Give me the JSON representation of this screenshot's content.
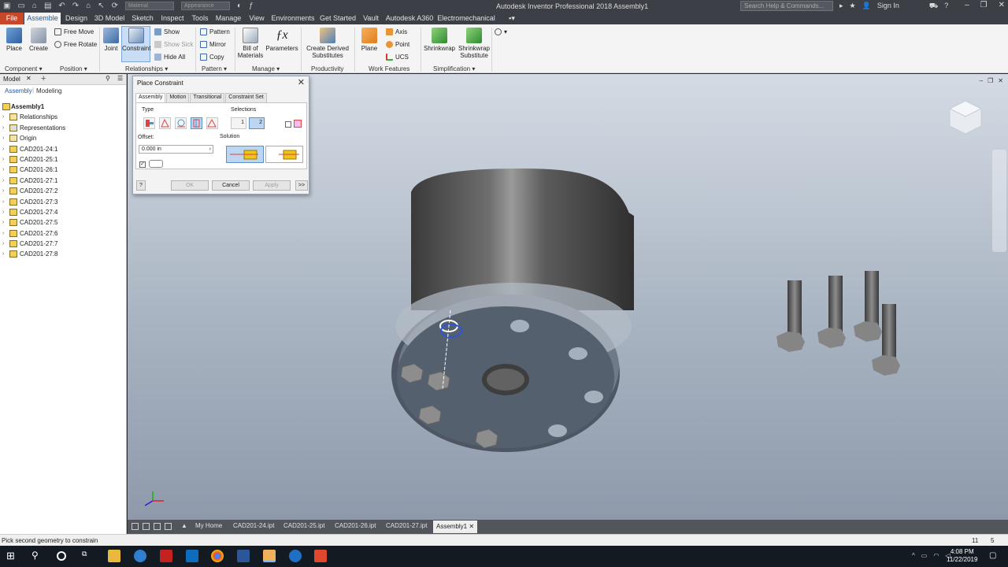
{
  "app": {
    "title": "Autodesk Inventor Professional 2018   Assembly1",
    "qat_combo_material": "Material",
    "qat_combo_appearance": "Appearance",
    "search_placeholder": "Search Help & Commands...",
    "sign_in": "Sign In"
  },
  "menu": {
    "tabs": [
      "File",
      "Assemble",
      "Design",
      "3D Model",
      "Sketch",
      "Inspect",
      "Tools",
      "Manage",
      "View",
      "Environments",
      "Get Started",
      "Vault",
      "Autodesk A360",
      "Electromechanical"
    ],
    "active": "Assemble"
  },
  "ribbon": {
    "place": "Place",
    "create": "Create",
    "free_move": "Free Move",
    "free_rotate": "Free Rotate",
    "joint": "Joint",
    "constraint": "Constraint",
    "show": "Show",
    "show_sick": "Show Sick",
    "hide_all": "Hide All",
    "pattern": "Pattern",
    "mirror": "Mirror",
    "copy": "Copy",
    "bill_of_materials_1": "Bill of",
    "bill_of_materials_2": "Materials",
    "parameters": "Parameters",
    "create_derived_1": "Create Derived",
    "create_derived_2": "Substitutes",
    "plane": "Plane",
    "axis": "Axis",
    "point": "Point",
    "ucs": "UCS",
    "shrinkwrap": "Shrinkwrap",
    "shrinkwrap_sub_1": "Shrinkwrap",
    "shrinkwrap_sub_2": "Substitute",
    "panels": {
      "component": "Component",
      "position": "Position",
      "relationships": "Relationships",
      "pattern": "Pattern",
      "manage": "Manage",
      "productivity": "Productivity",
      "work_features": "Work Features",
      "simplification": "Simplification"
    }
  },
  "browser": {
    "header": "Model",
    "tab_assembly": "Assembly",
    "tab_modeling": "Modeling",
    "root": "Assembly1",
    "items": [
      "Relationships",
      "Representations",
      "Origin",
      "CAD201-24:1",
      "CAD201-25:1",
      "CAD201-26:1",
      "CAD201-27:1",
      "CAD201-27:2",
      "CAD201-27:3",
      "CAD201-27:4",
      "CAD201-27:5",
      "CAD201-27:6",
      "CAD201-27:7",
      "CAD201-27:8"
    ]
  },
  "dialog": {
    "title": "Place Constraint",
    "tabs": [
      "Assembly",
      "Motion",
      "Transitional",
      "Constraint Set"
    ],
    "type_label": "Type",
    "selections_label": "Selections",
    "offset_label": "Offset:",
    "offset_value": "0.000 in",
    "solution_label": "Solution",
    "sel1": "1",
    "sel2": "2",
    "ok": "OK",
    "cancel": "Cancel",
    "apply": "Apply",
    "more": ">>"
  },
  "doc_tabs": {
    "items": [
      "My Home",
      "CAD201-24.ipt",
      "CAD201-25.ipt",
      "CAD201-26.ipt",
      "CAD201-27.ipt",
      "Assembly1"
    ],
    "active": "Assembly1"
  },
  "status": {
    "message": "Pick second geometry to constrain",
    "count1": "11",
    "count2": "5"
  },
  "taskbar": {
    "time": "4:08 PM",
    "date": "11/22/2019"
  }
}
